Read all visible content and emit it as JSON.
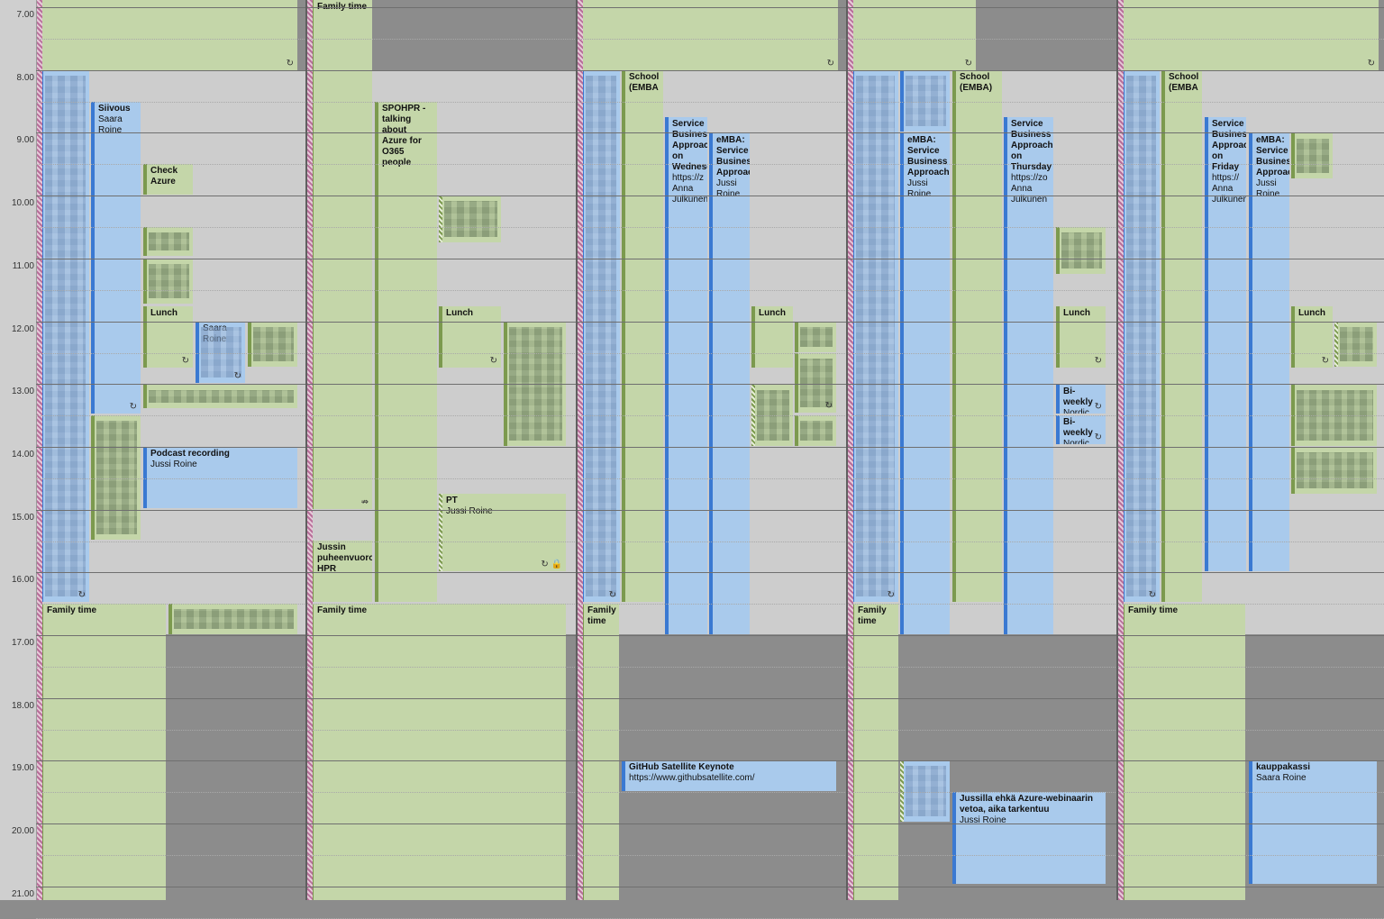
{
  "calendar": {
    "hours": [
      "7.00",
      "8.00",
      "9.00",
      "10.00",
      "11.00",
      "12.00",
      "13.00",
      "14.00",
      "15.00",
      "16.00",
      "17.00",
      "18.00",
      "19.00",
      "20.00",
      "21.00"
    ],
    "days": [
      {
        "work_start": 78,
        "work_end": 704,
        "recur_bar_top": 0,
        "events": [
          {
            "cls": "green bg",
            "l": 47,
            "t": 0,
            "w": 283,
            "h": 78,
            "title": "",
            "sub": "",
            "icon": "↻"
          },
          {
            "cls": "blue",
            "l": 44,
            "t": 78,
            "w": 55,
            "h": 590,
            "title": "",
            "sub": "",
            "blur": 1,
            "icon": "↻"
          },
          {
            "cls": "blue",
            "l": 101,
            "t": 113,
            "w": 55,
            "h": 346,
            "title": "Siivous",
            "sub": "Saara\nRoine",
            "icon": "↻"
          },
          {
            "cls": "green",
            "l": 159,
            "t": 182,
            "w": 55,
            "h": 34,
            "title": "Check\nAzure",
            "sub": ""
          },
          {
            "cls": "green",
            "l": 159,
            "t": 252,
            "w": 55,
            "h": 32,
            "title": "",
            "sub": "",
            "blur": 1
          },
          {
            "cls": "green",
            "l": 159,
            "t": 287,
            "w": 55,
            "h": 50,
            "title": "",
            "sub": "",
            "blur": 1
          },
          {
            "cls": "green",
            "l": 159,
            "t": 340,
            "w": 55,
            "h": 68,
            "title": "Lunch",
            "sub": "",
            "icon": "↻"
          },
          {
            "cls": "blue",
            "l": 217,
            "t": 357,
            "w": 55,
            "h": 68,
            "title": "",
            "sub": "Saara\nRoine",
            "blur": 1,
            "icon": "↻"
          },
          {
            "cls": "green",
            "l": 275,
            "t": 357,
            "w": 55,
            "h": 50,
            "title": "",
            "sub": "",
            "blur": 1
          },
          {
            "cls": "green",
            "l": 159,
            "t": 427,
            "w": 171,
            "h": 26,
            "title": "",
            "sub": "",
            "blur": 1
          },
          {
            "cls": "green",
            "l": 101,
            "t": 461,
            "w": 55,
            "h": 138,
            "title": "",
            "sub": "",
            "blur": 1
          },
          {
            "cls": "blue",
            "l": 159,
            "t": 496,
            "w": 171,
            "h": 68,
            "title": "Podcast recording",
            "sub": "Jussi Roine"
          },
          {
            "cls": "green",
            "l": 44,
            "t": 670,
            "w": 140,
            "h": 329,
            "title": "Family time",
            "sub": ""
          },
          {
            "cls": "green",
            "l": 187,
            "t": 670,
            "w": 143,
            "h": 34,
            "title": "",
            "sub": "",
            "blur": 1
          }
        ]
      },
      {
        "work_start": 78,
        "work_end": 704,
        "events": [
          {
            "cls": "green",
            "l": 344,
            "t": 0,
            "w": 69,
            "h": 565,
            "title": "Family time",
            "sub": "",
            "icon": "⇏"
          },
          {
            "cls": "green",
            "l": 416,
            "t": 113,
            "w": 69,
            "h": 555,
            "title": "SPOHPR -\ntalking\nabout\nAzure for\nO365\npeople",
            "sub": ""
          },
          {
            "cls": "green hatched",
            "l": 487,
            "t": 217,
            "w": 69,
            "h": 52,
            "title": "",
            "sub": "",
            "blur": 1
          },
          {
            "cls": "green",
            "l": 487,
            "t": 340,
            "w": 69,
            "h": 68,
            "title": "Lunch",
            "sub": "",
            "icon": "↻"
          },
          {
            "cls": "green",
            "l": 559,
            "t": 357,
            "w": 69,
            "h": 138,
            "title": "",
            "sub": "",
            "blur": 1
          },
          {
            "cls": "green hatched",
            "l": 487,
            "t": 548,
            "w": 141,
            "h": 86,
            "title": "PT",
            "sub": "Jussi Roine",
            "icon": "↻ 🔒"
          },
          {
            "cls": "green",
            "l": 344,
            "t": 600,
            "w": 69,
            "h": 68,
            "title": "Jussin\npuheenvuoro\nHPR",
            "sub": ""
          },
          {
            "cls": "green",
            "l": 344,
            "t": 670,
            "w": 284,
            "h": 329,
            "title": "Family time",
            "sub": ""
          }
        ]
      },
      {
        "work_start": 78,
        "work_end": 704,
        "events": [
          {
            "cls": "green bg",
            "l": 647,
            "t": 0,
            "w": 283,
            "h": 78,
            "title": "",
            "sub": "",
            "icon": "↻"
          },
          {
            "cls": "blue",
            "l": 644,
            "t": 78,
            "w": 44,
            "h": 590,
            "title": "",
            "sub": "",
            "blur": 1,
            "icon": "↻"
          },
          {
            "cls": "green",
            "l": 690,
            "t": 78,
            "w": 46,
            "h": 590,
            "title": "School\n(EMBA",
            "sub": ""
          },
          {
            "cls": "blue",
            "l": 738,
            "t": 130,
            "w": 47,
            "h": 574,
            "title": "Service\nBusiness\nApproach\non\nWednesday",
            "sub": "https://z\nAnna\nJulkunen"
          },
          {
            "cls": "blue",
            "l": 787,
            "t": 148,
            "w": 45,
            "h": 556,
            "title": "eMBA:\nService\nBusiness\nApproach",
            "sub": "Jussi\nRoine"
          },
          {
            "cls": "green",
            "l": 834,
            "t": 340,
            "w": 46,
            "h": 68,
            "title": "Lunch",
            "sub": ""
          },
          {
            "cls": "green",
            "l": 882,
            "t": 357,
            "w": 46,
            "h": 34,
            "title": "",
            "sub": "",
            "blur": 1
          },
          {
            "cls": "green",
            "l": 882,
            "t": 392,
            "w": 46,
            "h": 66,
            "title": "",
            "sub": "",
            "blur": 1,
            "icon": "↻"
          },
          {
            "cls": "green hatched",
            "l": 834,
            "t": 427,
            "w": 46,
            "h": 68,
            "title": "",
            "sub": "",
            "blur": 1
          },
          {
            "cls": "green",
            "l": 882,
            "t": 461,
            "w": 46,
            "h": 34,
            "title": "",
            "sub": "",
            "blur": 1
          },
          {
            "cls": "green",
            "l": 644,
            "t": 670,
            "w": 43,
            "h": 329,
            "title": "Family\ntime",
            "sub": ""
          },
          {
            "cls": "blue",
            "l": 690,
            "t": 844,
            "w": 238,
            "h": 34,
            "title": "GitHub Satellite Keynote",
            "sub": "https://www.githubsatellite.com/"
          }
        ]
      },
      {
        "work_start": 78,
        "work_end": 704,
        "events": [
          {
            "cls": "green bg",
            "l": 947,
            "t": 0,
            "w": 136,
            "h": 78,
            "title": "",
            "sub": "",
            "icon": "↻"
          },
          {
            "cls": "blue",
            "l": 944,
            "t": 78,
            "w": 53,
            "h": 590,
            "title": "",
            "sub": "",
            "blur": 1,
            "icon": "↻"
          },
          {
            "cls": "blue",
            "l": 999,
            "t": 78,
            "w": 55,
            "h": 68,
            "title": "",
            "sub": "",
            "blur": 1
          },
          {
            "cls": "blue",
            "l": 999,
            "t": 148,
            "w": 55,
            "h": 556,
            "title": "eMBA:\nService\nBusiness\nApproach",
            "sub": "Jussi\nRoine"
          },
          {
            "cls": "green",
            "l": 1057,
            "t": 78,
            "w": 55,
            "h": 590,
            "title": "School\n(EMBA)",
            "sub": ""
          },
          {
            "cls": "blue",
            "l": 1114,
            "t": 130,
            "w": 55,
            "h": 574,
            "title": "Service\nBusiness\nApproach\non\nThursday",
            "sub": "https://zo\nAnna\nJulkunen"
          },
          {
            "cls": "green",
            "l": 1172,
            "t": 252,
            "w": 55,
            "h": 52,
            "title": "",
            "sub": "",
            "blur": 1
          },
          {
            "cls": "green",
            "l": 1172,
            "t": 340,
            "w": 55,
            "h": 68,
            "title": "Lunch",
            "sub": "",
            "icon": "↻"
          },
          {
            "cls": "blue",
            "l": 1172,
            "t": 427,
            "w": 55,
            "h": 32,
            "title": "Bi-weekly",
            "sub": "Nordic",
            "icon": "↻"
          },
          {
            "cls": "blue",
            "l": 1172,
            "t": 461,
            "w": 55,
            "h": 32,
            "title": "Bi-weekly",
            "sub": "Nordic",
            "icon": "↻"
          },
          {
            "cls": "green",
            "l": 944,
            "t": 670,
            "w": 53,
            "h": 329,
            "title": "Family\ntime",
            "sub": ""
          },
          {
            "cls": "blue hatched",
            "l": 999,
            "t": 844,
            "w": 55,
            "h": 68,
            "title": "",
            "sub": "",
            "blur": 1
          },
          {
            "cls": "blue",
            "l": 1057,
            "t": 879,
            "w": 170,
            "h": 102,
            "title": "Jussilla ehkä Azure-webinaarin\nvetoa, aika tarkentuu",
            "sub": "Jussi Roine"
          }
        ]
      },
      {
        "work_start": 78,
        "work_end": 704,
        "events": [
          {
            "cls": "green bg",
            "l": 1247,
            "t": 0,
            "w": 283,
            "h": 78,
            "title": "",
            "sub": "",
            "icon": "↻"
          },
          {
            "cls": "blue",
            "l": 1244,
            "t": 78,
            "w": 43,
            "h": 590,
            "title": "",
            "sub": "",
            "blur": 1,
            "icon": "↻"
          },
          {
            "cls": "green",
            "l": 1289,
            "t": 78,
            "w": 45,
            "h": 590,
            "title": "School\n(EMBA",
            "sub": ""
          },
          {
            "cls": "blue",
            "l": 1337,
            "t": 130,
            "w": 46,
            "h": 504,
            "title": "Service\nBusiness\nApproach\non\nFriday",
            "sub": "https://\nAnna\nJulkunen"
          },
          {
            "cls": "blue",
            "l": 1386,
            "t": 148,
            "w": 45,
            "h": 486,
            "title": "eMBA:\nService\nBusiness\nApproach",
            "sub": "Jussi\nRoine"
          },
          {
            "cls": "green",
            "l": 1433,
            "t": 148,
            "w": 46,
            "h": 50,
            "title": "",
            "sub": "",
            "blur": 1
          },
          {
            "cls": "green",
            "l": 1433,
            "t": 340,
            "w": 46,
            "h": 68,
            "title": "Lunch",
            "sub": "",
            "icon": "↻"
          },
          {
            "cls": "green hatched",
            "l": 1481,
            "t": 357,
            "w": 47,
            "h": 50,
            "title": "",
            "sub": "",
            "blur": 1
          },
          {
            "cls": "green",
            "l": 1433,
            "t": 427,
            "w": 95,
            "h": 68,
            "title": "",
            "sub": "",
            "blur": 1
          },
          {
            "cls": "green",
            "l": 1433,
            "t": 496,
            "w": 95,
            "h": 52,
            "title": "",
            "sub": "",
            "blur": 1
          },
          {
            "cls": "green",
            "l": 1244,
            "t": 670,
            "w": 138,
            "h": 329,
            "title": "Family time",
            "sub": ""
          },
          {
            "cls": "blue",
            "l": 1386,
            "t": 844,
            "w": 142,
            "h": 137,
            "title": "kauppakassi",
            "sub": "Saara Roine"
          }
        ]
      }
    ]
  }
}
